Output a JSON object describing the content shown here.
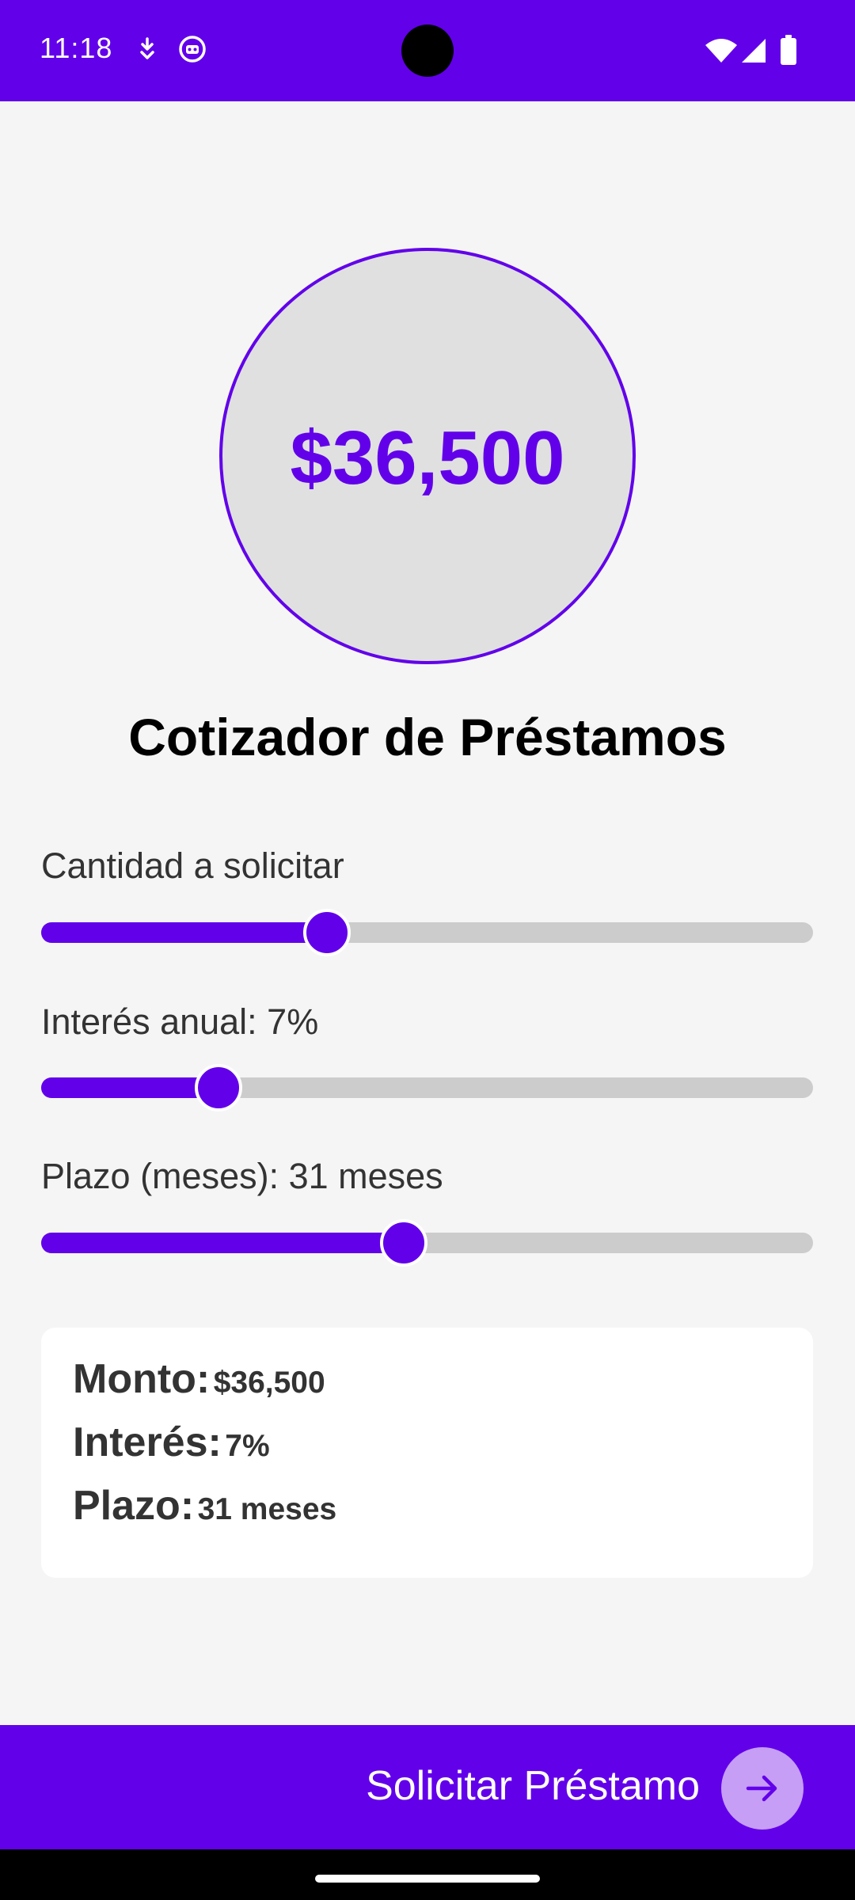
{
  "status_bar": {
    "time": "11:18",
    "left_icons": [
      "download-icon",
      "assistant-icon"
    ],
    "right_icons": [
      "wifi-icon",
      "signal-icon",
      "battery-icon"
    ],
    "background": "#6200ea"
  },
  "amount_display": "$36,500",
  "page_title": "Cotizador de Préstamos",
  "sliders": [
    {
      "label": "Cantidad a solicitar",
      "fraction": 0.37
    },
    {
      "label": "Interés anual: 7%",
      "fraction": 0.23
    },
    {
      "label": "Plazo (meses): 31 meses",
      "fraction": 0.47
    }
  ],
  "summary": {
    "amount_key": "Monto:",
    "amount_value": "$36,500",
    "interest_key": "Interés:",
    "interest_value": "7%",
    "term_key": "Plazo:",
    "term_value": "31 meses"
  },
  "cta": {
    "label": "Solicitar Préstamo",
    "icon": "arrow-right-icon"
  },
  "colors": {
    "accent": "#6200ea",
    "track": "#cccccc",
    "circle_bg": "#e0e0e0",
    "fab": "#c69ef6"
  }
}
